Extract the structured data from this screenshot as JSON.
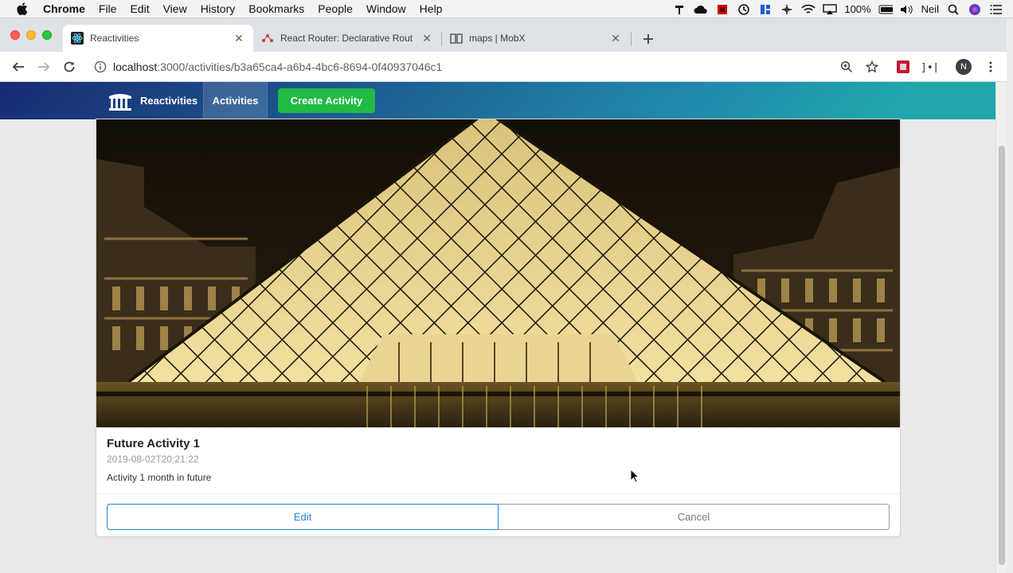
{
  "menubar": {
    "app_name": "Chrome",
    "items": [
      "File",
      "Edit",
      "View",
      "History",
      "Bookmarks",
      "People",
      "Window",
      "Help"
    ],
    "battery": "100%",
    "user": "Neil"
  },
  "tabs": [
    {
      "title": "Reactivities",
      "active": true
    },
    {
      "title": "React Router: Declarative Rout",
      "active": false
    },
    {
      "title": "maps | MobX",
      "active": false
    }
  ],
  "address_bar": {
    "host": "localhost",
    "path": ":3000/activities/b3a65ca4-a6b4-4bc6-8694-0f40937046c1"
  },
  "profile": {
    "initial": "N"
  },
  "nav": {
    "brand": "Reactivities",
    "activities": "Activities",
    "create_activity": "Create Activity"
  },
  "activity": {
    "title": "Future Activity 1",
    "date": "2019-08-02T20:21:22",
    "description": "Activity 1 month in future",
    "edit_label": "Edit",
    "cancel_label": "Cancel"
  },
  "colors": {
    "nav_gradient_start": "#182a73",
    "nav_gradient_end": "#20a7ac",
    "create_button": "#21ba45",
    "edit_button": "#2185d0"
  }
}
